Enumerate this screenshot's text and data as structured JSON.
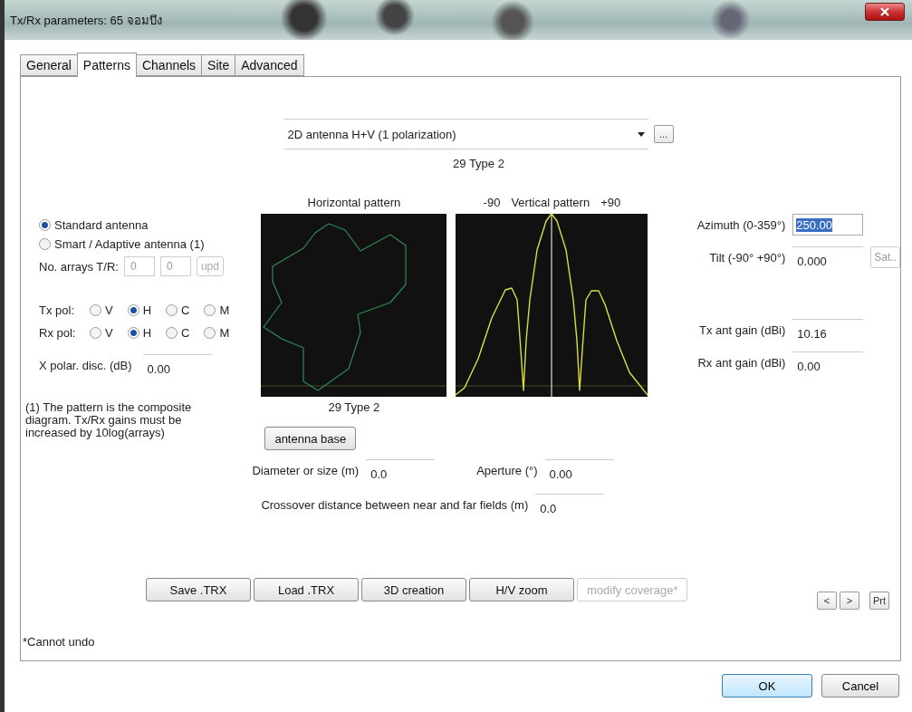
{
  "window": {
    "title": "Tx/Rx parameters: 65 จอมบึง"
  },
  "tabs": [
    {
      "label": "General",
      "selected": false
    },
    {
      "label": "Patterns",
      "selected": true
    },
    {
      "label": "Channels",
      "selected": false
    },
    {
      "label": "Site",
      "selected": false
    },
    {
      "label": "Advanced",
      "selected": false
    }
  ],
  "antenna_type": {
    "value": "2D antenna H+V (1 polarization)",
    "more_button": "..."
  },
  "pattern_name": "29 Type 2",
  "antenna_mode": [
    {
      "label": "Standard antenna",
      "selected": true
    },
    {
      "label": "Smart / Adaptive antenna (1)",
      "selected": false
    }
  ],
  "arrays": {
    "label": "No. arrays T/R:",
    "tx": "0",
    "rx": "0",
    "button": "upd",
    "disabled": true
  },
  "polarizations": [
    {
      "label": "Tx pol:",
      "options": [
        {
          "label": "V",
          "selected": false
        },
        {
          "label": "H",
          "selected": true
        },
        {
          "label": "C",
          "selected": false
        },
        {
          "label": "M",
          "selected": false
        }
      ]
    },
    {
      "label": "Rx pol:",
      "options": [
        {
          "label": "V",
          "selected": false
        },
        {
          "label": "H",
          "selected": true
        },
        {
          "label": "C",
          "selected": false
        },
        {
          "label": "M",
          "selected": false
        }
      ]
    }
  ],
  "x_polar": {
    "label": "X polar. disc. (dB)",
    "value": "0.00"
  },
  "note": "(1) The pattern is the composite diagram. Tx/Rx gains must be increased by 10log(arrays)",
  "horizontal_pattern": {
    "title": "Horizontal pattern",
    "caption": "29 Type 2"
  },
  "vertical_pattern": {
    "left_label": "-90",
    "title": "Vertical pattern",
    "right_label": "+90"
  },
  "antenna_base_button": "antenna base",
  "diameter": {
    "label": "Diameter or size (m)",
    "value": "0.0"
  },
  "aperture": {
    "label": "Aperture (°)",
    "value": "0.00"
  },
  "crossover": {
    "label": "Crossover distance between near and far fields (m)",
    "value": "0.0"
  },
  "right_fields": [
    {
      "label": "Azimuth (0-359°)",
      "value": "250.00",
      "selected": true
    },
    {
      "label": "Tilt (-90° +90°)",
      "value": "0.000",
      "selected": false,
      "button": "Sat.."
    },
    {
      "label": "Tx ant gain (dBi)",
      "value": "10.16",
      "selected": false
    },
    {
      "label": "Rx ant gain (dBi)",
      "value": "0.00",
      "selected": false
    }
  ],
  "action_buttons": [
    {
      "label": "Save .TRX",
      "disabled": false
    },
    {
      "label": "Load .TRX",
      "disabled": false
    },
    {
      "label": "3D creation",
      "disabled": false
    },
    {
      "label": "H/V zoom",
      "disabled": false
    },
    {
      "label": "modify coverage*",
      "disabled": true
    }
  ],
  "nav_buttons": [
    "<",
    ">"
  ],
  "print_button": "Prt",
  "footnote": "*Cannot undo",
  "dialog_buttons": [
    {
      "label": "OK",
      "default": true
    },
    {
      "label": "Cancel",
      "default": false
    }
  ]
}
